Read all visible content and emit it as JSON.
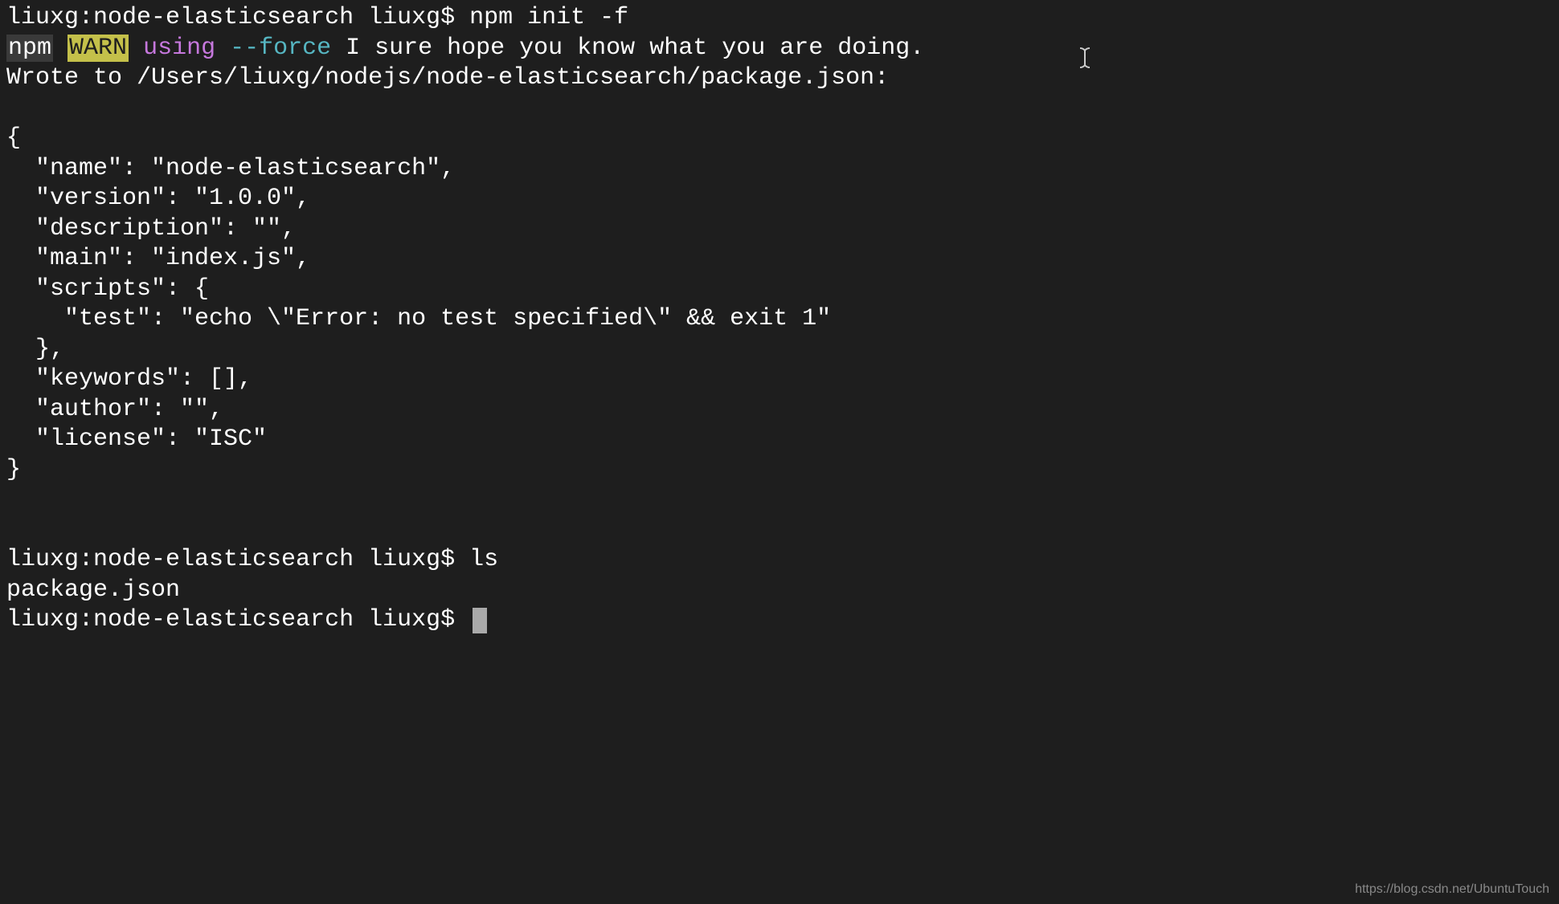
{
  "line1": {
    "prompt": "liuxg:node-elasticsearch liuxg$ ",
    "command": "npm init -f"
  },
  "line2": {
    "npm": "npm",
    "warn": "WARN",
    "using": "using",
    "force": "--force",
    "message": " I sure hope you know what you are doing."
  },
  "line3": "Wrote to /Users/liuxg/nodejs/node-elasticsearch/package.json:",
  "json": {
    "l1": "{",
    "l2": "  \"name\": \"node-elasticsearch\",",
    "l3": "  \"version\": \"1.0.0\",",
    "l4": "  \"description\": \"\",",
    "l5": "  \"main\": \"index.js\",",
    "l6": "  \"scripts\": {",
    "l7": "    \"test\": \"echo \\\"Error: no test specified\\\" && exit 1\"",
    "l8": "  },",
    "l9": "  \"keywords\": [],",
    "l10": "  \"author\": \"\",",
    "l11": "  \"license\": \"ISC\"",
    "l12": "}"
  },
  "line_ls": {
    "prompt": "liuxg:node-elasticsearch liuxg$ ",
    "command": "ls"
  },
  "ls_output": "package.json",
  "line_final": {
    "prompt": "liuxg:node-elasticsearch liuxg$ "
  },
  "watermark": "https://blog.csdn.net/UbuntuTouch"
}
